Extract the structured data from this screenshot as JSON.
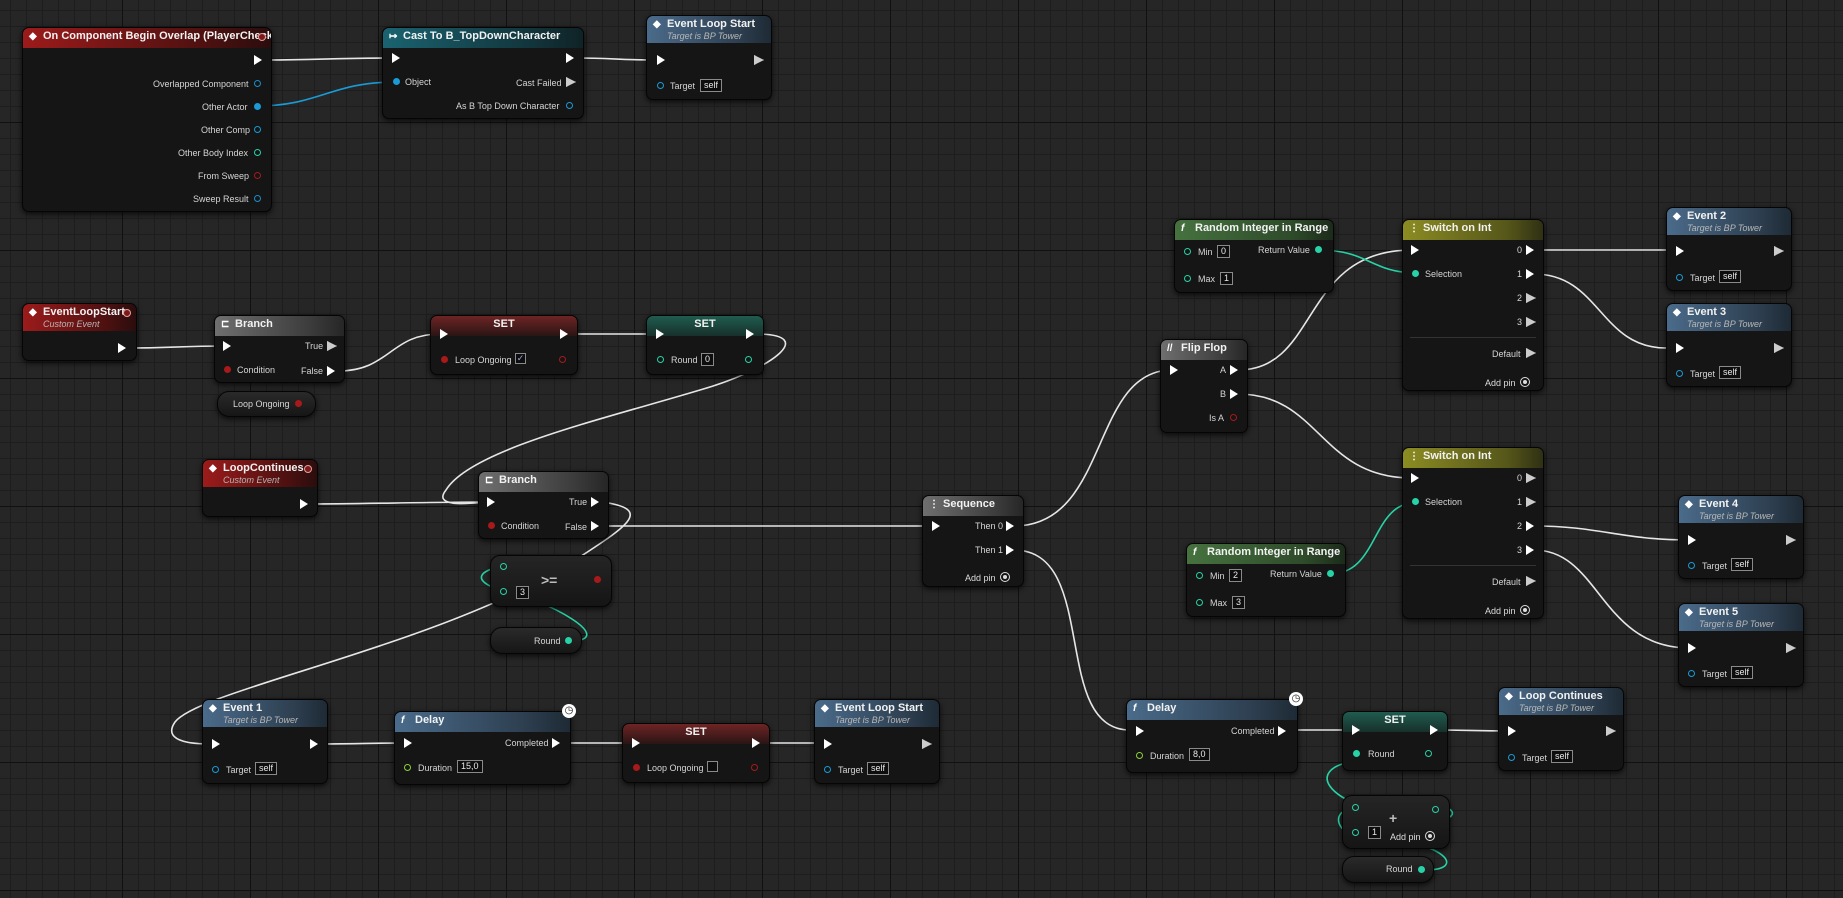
{
  "nodes": {
    "begin_overlap": {
      "title": "On Component Begin Overlap (PlayerChecker)",
      "pins": [
        "Overlapped Component",
        "Other Actor",
        "Other Comp",
        "Other Body Index",
        "From Sweep",
        "Sweep Result"
      ]
    },
    "cast": {
      "title": "Cast To B_TopDownCharacter",
      "object": "Object",
      "cast_failed": "Cast Failed",
      "as_char": "As B Top Down Character"
    },
    "loop_start_top": {
      "title": "Event Loop Start",
      "subtitle": "Target is BP Tower",
      "target": "Target",
      "self": "self"
    },
    "event_loop_start": {
      "title": "EventLoopStart",
      "subtitle": "Custom Event"
    },
    "branch1": {
      "title": "Branch",
      "true": "True",
      "false": "False",
      "condition": "Condition"
    },
    "get_loop_ongoing": {
      "label": "Loop Ongoing"
    },
    "set_loop_ongoing_true": {
      "title": "SET",
      "label": "Loop Ongoing",
      "checked": "✓"
    },
    "set_round0": {
      "title": "SET",
      "label": "Round",
      "value": "0"
    },
    "loop_continues": {
      "title": "LoopContinues",
      "subtitle": "Custom Event"
    },
    "branch2": {
      "title": "Branch",
      "true": "True",
      "false": "False",
      "condition": "Condition"
    },
    "compare": {
      "op": ">=",
      "value": "3"
    },
    "get_round1": {
      "label": "Round"
    },
    "event1": {
      "title": "Event 1",
      "subtitle": "Target is BP Tower",
      "target": "Target",
      "self": "self"
    },
    "delay1": {
      "title": "Delay",
      "completed": "Completed",
      "duration": "Duration",
      "value": "15,0"
    },
    "set_loop_ongoing_false": {
      "title": "SET",
      "label": "Loop Ongoing"
    },
    "loop_start_bottom": {
      "title": "Event Loop Start",
      "subtitle": "Target is BP Tower",
      "target": "Target",
      "self": "self"
    },
    "sequence": {
      "title": "Sequence",
      "then0": "Then 0",
      "then1": "Then 1",
      "add_pin": "Add pin"
    },
    "flipflop": {
      "title": "Flip Flop",
      "a": "A",
      "b": "B",
      "is_a": "Is A"
    },
    "rand1": {
      "title": "Random Integer in Range",
      "min": "Min",
      "min_val": "0",
      "max": "Max",
      "max_val": "1",
      "ret": "Return Value"
    },
    "switch1": {
      "title": "Switch on Int",
      "selection": "Selection",
      "outs": [
        "0",
        "1",
        "2",
        "3"
      ],
      "default": "Default",
      "add_pin": "Add pin"
    },
    "rand2": {
      "title": "Random Integer in Range",
      "min": "Min",
      "min_val": "2",
      "max": "Max",
      "max_val": "3",
      "ret": "Return Value"
    },
    "switch2": {
      "title": "Switch on Int",
      "selection": "Selection",
      "outs": [
        "0",
        "1",
        "2",
        "3"
      ],
      "default": "Default",
      "add_pin": "Add pin"
    },
    "event2": {
      "title": "Event 2",
      "subtitle": "Target is BP Tower",
      "target": "Target",
      "self": "self"
    },
    "event3": {
      "title": "Event 3",
      "subtitle": "Target is BP Tower",
      "target": "Target",
      "self": "self"
    },
    "event4": {
      "title": "Event 4",
      "subtitle": "Target is BP Tower",
      "target": "Target",
      "self": "self"
    },
    "event5": {
      "title": "Event 5",
      "subtitle": "Target is BP Tower",
      "target": "Target",
      "self": "self"
    },
    "delay2": {
      "title": "Delay",
      "completed": "Completed",
      "duration": "Duration",
      "value": "8,0"
    },
    "set_round2": {
      "title": "SET",
      "label": "Round"
    },
    "add_node": {
      "op": "+",
      "value": "1",
      "add_pin": "Add pin"
    },
    "get_round2": {
      "label": "Round"
    },
    "loop_continues_call": {
      "title": "Loop Continues",
      "subtitle": "Target is BP Tower",
      "target": "Target",
      "self": "self"
    }
  },
  "colors": {
    "exec": "#ffffff",
    "object": "#1a9bd6",
    "integer": "#27d3a6",
    "boolean": "#a81a1a",
    "event_header": "#9c1b1b",
    "function_header": "#4a6b8a",
    "cast_header": "#1a6370",
    "switch_header": "#8c8c23"
  }
}
